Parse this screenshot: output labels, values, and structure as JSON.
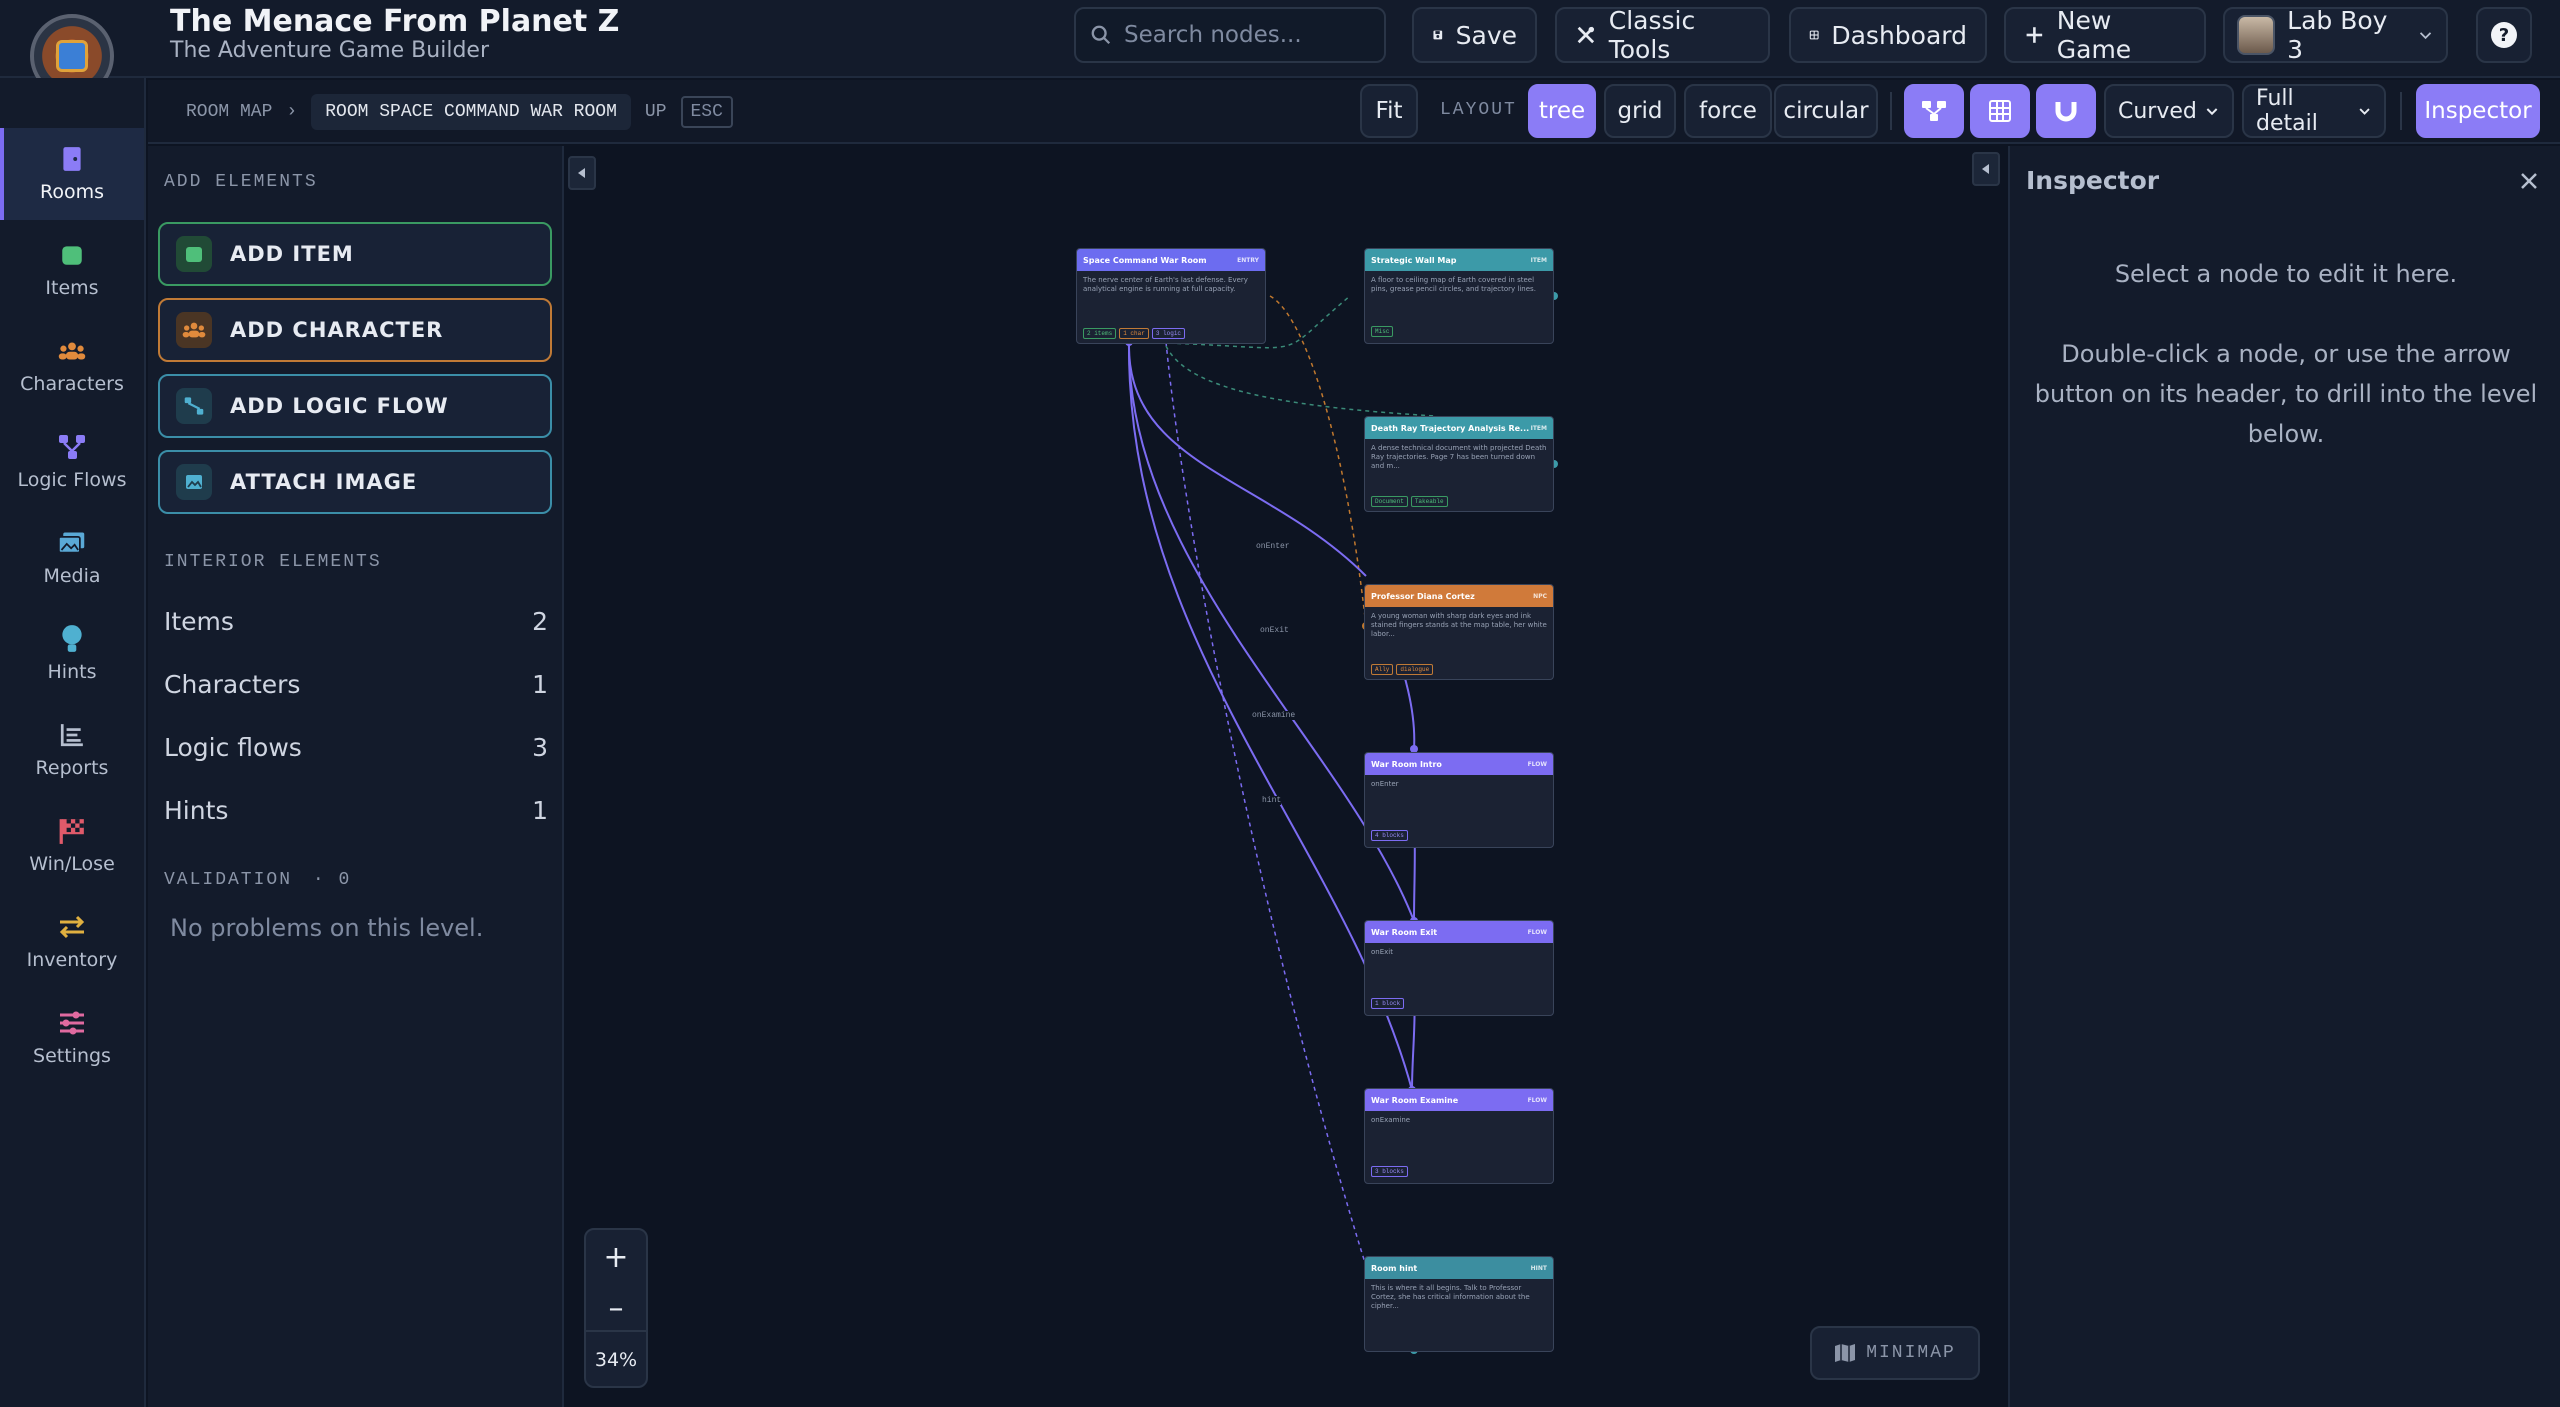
{
  "app": {
    "title": "The Menace From Planet Z",
    "subtitle": "The Adventure Game Builder"
  },
  "topbar": {
    "search_placeholder": "Search nodes...",
    "save": "Save",
    "classic_tools": "Classic Tools",
    "dashboard": "Dashboard",
    "new_game": "New Game",
    "user_name": "Lab Boy 3",
    "help": "?"
  },
  "nav": {
    "items": [
      {
        "label": "Rooms",
        "icon": "door-icon",
        "color": "#8b7cf6"
      },
      {
        "label": "Items",
        "icon": "item-icon",
        "color": "#4fbf7a"
      },
      {
        "label": "Characters",
        "icon": "people-icon",
        "color": "#e08a3c"
      },
      {
        "label": "Logic Flows",
        "icon": "flow-icon",
        "color": "#8b7cf6"
      },
      {
        "label": "Media",
        "icon": "image-icon",
        "color": "#5aa9d6"
      },
      {
        "label": "Hints",
        "icon": "bulb-icon",
        "color": "#4fb0d0"
      },
      {
        "label": "Reports",
        "icon": "list-icon",
        "color": "#b6bfcf"
      },
      {
        "label": "Win/Lose",
        "icon": "flag-icon",
        "color": "#e05a6a"
      },
      {
        "label": "Inventory",
        "icon": "swap-icon",
        "color": "#e0b040"
      },
      {
        "label": "Settings",
        "icon": "sliders-icon",
        "color": "#e06aa0"
      }
    ]
  },
  "toolbar": {
    "breadcrumb_root": "ROOM MAP",
    "breadcrumb_sep": "›",
    "breadcrumb_current": "ROOM SPACE COMMAND WAR ROOM",
    "up": "UP",
    "esc": "ESC",
    "fit": "Fit",
    "layout_label": "LAYOUT",
    "layout_options": [
      "tree",
      "grid",
      "force",
      "circular"
    ],
    "layout_active": "tree",
    "edge_style": "Curved",
    "detail_level": "Full detail",
    "inspector": "Inspector"
  },
  "left_panel": {
    "add_title": "ADD ELEMENTS",
    "add_buttons": [
      {
        "label": "ADD ITEM",
        "color": "#4fbf7a"
      },
      {
        "label": "ADD CHARACTER",
        "color": "#e08a3c"
      },
      {
        "label": "ADD LOGIC FLOW",
        "color": "#4fb0d0"
      },
      {
        "label": "ATTACH IMAGE",
        "color": "#4fb0d0"
      }
    ],
    "interior_title": "INTERIOR ELEMENTS",
    "counts": [
      {
        "label": "Items",
        "value": "2"
      },
      {
        "label": "Characters",
        "value": "1"
      },
      {
        "label": "Logic flows",
        "value": "3"
      },
      {
        "label": "Hints",
        "value": "1"
      }
    ],
    "validation_title": "VALIDATION",
    "validation_count": "· 0",
    "no_problems": "No problems on this level."
  },
  "graph": {
    "nodes": [
      {
        "title": "Space Command War Room",
        "badge": "ENTRY",
        "color": "#6c6cf0",
        "body": "The nerve center of Earth's last defense. Every analytical engine is running at full capacity.",
        "tags": [
          "2 items",
          "1 char",
          "3 logic"
        ]
      },
      {
        "title": "Strategic Wall Map",
        "badge": "ITEM",
        "color": "#3c9aa8",
        "body": "A floor to ceiling map of Earth covered in steel pins, grease pencil circles, and trajectory lines.",
        "tags": [
          "Misc"
        ]
      },
      {
        "title": "Death Ray Trajectory Analysis Re...",
        "badge": "ITEM",
        "color": "#3c9aa8",
        "body": "A dense technical document with projected Death Ray trajectories. Page 7 has been turned down and m...",
        "tags": [
          "Document",
          "Takeable"
        ]
      },
      {
        "title": "Professor Diana Cortez",
        "badge": "NPC",
        "color": "#d07a3a",
        "body": "A young woman with sharp dark eyes and ink stained fingers stands at the map table, her white labor...",
        "tags": [
          "Ally",
          "dialogue"
        ]
      },
      {
        "title": "War Room Intro",
        "badge": "FLOW",
        "color": "#7c6cf2",
        "body": "onEnter",
        "tags": [
          "4 blocks"
        ]
      },
      {
        "title": "War Room Exit",
        "badge": "FLOW",
        "color": "#7c6cf2",
        "body": "onExit",
        "tags": [
          "1 block"
        ]
      },
      {
        "title": "War Room Examine",
        "badge": "FLOW",
        "color": "#7c6cf2",
        "body": "onExamine",
        "tags": [
          "3 blocks"
        ]
      },
      {
        "title": "Room hint",
        "badge": "HINT",
        "color": "#3c8ea0",
        "body": "This is where it all begins. Talk to Professor Cortez, she has critical information about the cipher...",
        "tags": []
      }
    ],
    "edge_labels": [
      "onEnter",
      "onExit",
      "onExamine",
      "hint"
    ],
    "zoom_in": "+",
    "zoom_out": "–",
    "zoom_level": "34%",
    "minimap": "MINIMAP"
  },
  "inspector": {
    "title": "Inspector",
    "line1": "Select a node to edit it here.",
    "line2": "Double-click a node, or use the arrow button on its header, to drill into the level below."
  }
}
